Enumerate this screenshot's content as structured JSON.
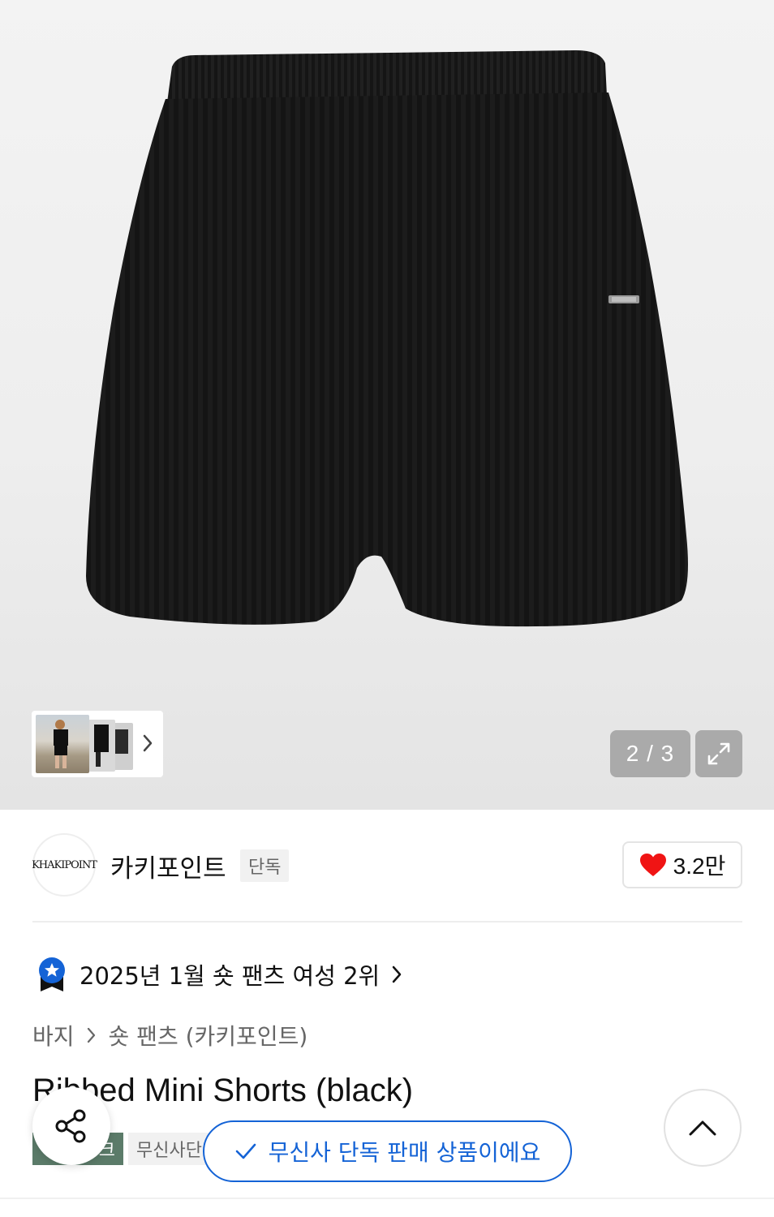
{
  "gallery": {
    "product_image_icon": "ribbed-knit-shorts-image",
    "thumbnail_icon": "model-photo-thumbnails",
    "page_counter": "2 / 3",
    "current_page": 2,
    "total_pages": 3,
    "expand_icon": "expand-icon"
  },
  "brand": {
    "logo_text": "KHAKIPOINT",
    "name": "카키포인트",
    "exclusive_tag": "단독",
    "like_count": "3.2만",
    "heart_color": "#f01414"
  },
  "ranking": {
    "text": "2025년 1월 숏 팬츠 여성 2위",
    "badge_color": "#1463d6"
  },
  "breadcrumb": {
    "items": [
      "바지",
      "숏 팬츠 (카키포인트)"
    ]
  },
  "product": {
    "title": "Ribbed Mini Shorts (black)",
    "badges": {
      "green_partial": "크",
      "gray_partial": "무신사단"
    }
  },
  "toast": {
    "text": "무신사 단독 판매 상품이에요",
    "color": "#1463d6"
  },
  "icons": {
    "share": "share-icon",
    "scroll_top": "chevron-up-icon",
    "check": "check-icon"
  }
}
